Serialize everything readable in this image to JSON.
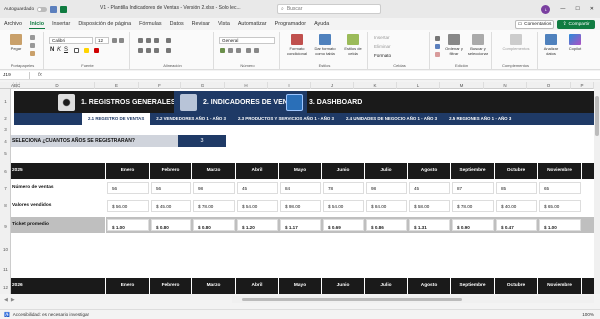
{
  "titlebar": {
    "autosave_label": "Autoguardado",
    "doc_title": "V1 - Plantilla Indicadores de Ventas - Versión 2.xlsx  -  Solo lec...",
    "search_placeholder": "Buscar",
    "avatar_initial": "L"
  },
  "menu": {
    "items": [
      "Archivo",
      "Inicio",
      "Insertar",
      "Disposición de página",
      "Fórmulas",
      "Datos",
      "Revisar",
      "Vista",
      "Automatizar",
      "Programador",
      "Ayuda"
    ],
    "comments_label": "Comentarios",
    "share_label": "Compartir"
  },
  "ribbon": {
    "paste_label": "Pegar",
    "clipboard_label": "Portapapeles",
    "font_name": "Calibri",
    "font_size": "12",
    "font_group_label": "Fuente",
    "align_group_label": "Alineación",
    "number_format": "General",
    "number_group_label": "Número",
    "cond_format_label": "Formato condicional",
    "table_format_label": "Dar formato como tabla",
    "cell_styles_label": "Estilos de celda",
    "styles_group_label": "Estilos",
    "insert_label": "Insertar",
    "delete_label": "Eliminar",
    "format_label": "Formato",
    "cells_group_label": "Celdas",
    "sort_label": "Ordenar y filtrar",
    "find_label": "Buscar y seleccionar",
    "editing_group_label": "Edición",
    "addins_label": "Complementos",
    "addins_group_label": "Complementos",
    "analyze_label": "Analizar datos",
    "copilot_label": "Copilot"
  },
  "formula_bar": {
    "cell_ref": "J19",
    "fx": "fx"
  },
  "columns": [
    "A",
    "B",
    "C",
    "D",
    "E",
    "F",
    "G",
    "H",
    "I",
    "J",
    "K",
    "L",
    "M",
    "N",
    "O",
    "P"
  ],
  "rows": [
    "1",
    "2",
    "3",
    "4",
    "5",
    "6",
    "7",
    "8",
    "9",
    "10",
    "11",
    "12"
  ],
  "nav": {
    "tab1": "1. REGISTROS GENERALES",
    "tab2": "2. INDICADORES DE VENTAS",
    "tab3": "3. DASHBOARD"
  },
  "subnav": [
    "2.1 REGISTRO DE VENTAS",
    "2.2 VENDEDORES AÑO 1 - AÑO 3",
    "2.3 PRODUCTOS Y SERVICIOS  AÑO 1 - AÑO 3",
    "2.4 UNIDADES DE NEGOCIO AÑO 1 - AÑO 3",
    "2.5 REGIONES AÑO 1 - AÑO 3"
  ],
  "question": {
    "label": "SELECIONA ¿CUANTOS AÑOS  SE REGISTRARAN?",
    "value": "3"
  },
  "table_2025": {
    "year": "2025",
    "months": [
      "Enero",
      "Febrero",
      "Marzo",
      "Abril",
      "Mayo",
      "Junio",
      "Julio",
      "Agosto",
      "Septiembre",
      "Octubre",
      "Noviembre"
    ],
    "rows": [
      {
        "label": "Número de ventas",
        "values": [
          "56",
          "56",
          "98",
          "45",
          "84",
          "78",
          "98",
          "45",
          "87",
          "85",
          "65"
        ]
      },
      {
        "label": "Valores vendidos",
        "values": [
          "$ 56.00",
          "$ 45.00",
          "$ 78.00",
          "$ 54.00",
          "$ 98.00",
          "$ 54.00",
          "$ 84.00",
          "$ 58.00",
          "$ 78.00",
          "$ 40.00",
          "$ 65.00"
        ]
      },
      {
        "label": "Ticket promedio",
        "values": [
          "$ 1.00",
          "$ 0.80",
          "$ 0.80",
          "$ 1.20",
          "$ 1.17",
          "$ 0.69",
          "$ 0.86",
          "$ 1.31",
          "$ 0.90",
          "$ 0.47",
          "$ 1.00"
        ]
      }
    ]
  },
  "table_2026": {
    "year": "2026",
    "months": [
      "Enero",
      "Febrero",
      "Marzo",
      "Abril",
      "Mayo",
      "Junio",
      "Julio",
      "Agosto",
      "Septiembre",
      "Octubre",
      "Noviembre"
    ]
  },
  "status": {
    "accessibility": "Accesibilidad: es necesario investigar",
    "zoom": "100%"
  }
}
